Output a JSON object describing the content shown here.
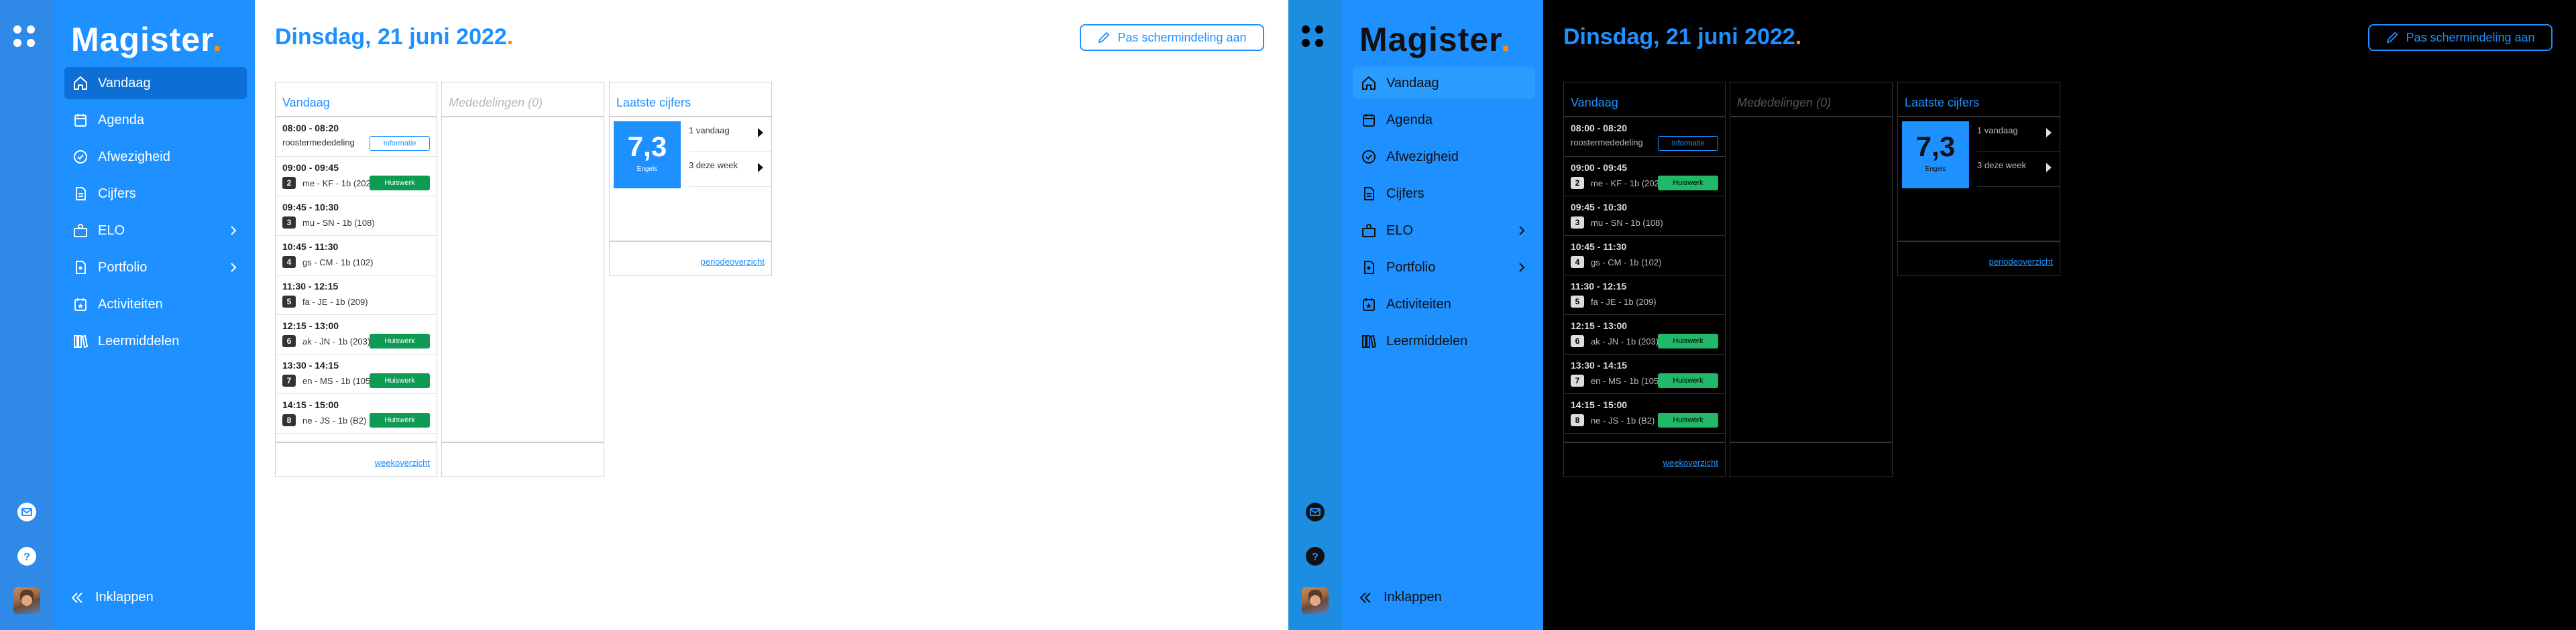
{
  "brand": {
    "name": "Magister",
    "dot": ".",
    "accent": "#1e90ff",
    "dot_color": "#ff8c00"
  },
  "date_title": "Dinsdag, 21 juni 2022",
  "date_dot": ".",
  "header_button": "Pas schermindeling aan",
  "nav": [
    {
      "label": "Vandaag",
      "icon": "home-icon",
      "active": true
    },
    {
      "label": "Agenda",
      "icon": "calendar-icon"
    },
    {
      "label": "Afwezigheid",
      "icon": "check-circle-icon"
    },
    {
      "label": "Cijfers",
      "icon": "grades-icon"
    },
    {
      "label": "ELO",
      "icon": "elo-icon",
      "submenu": true
    },
    {
      "label": "Portfolio",
      "icon": "portfolio-icon",
      "submenu": true
    },
    {
      "label": "Activiteiten",
      "icon": "activities-icon"
    },
    {
      "label": "Leermiddelen",
      "icon": "books-icon"
    }
  ],
  "collapse_label": "Inklappen",
  "vandaag": {
    "title": "Vandaag",
    "footer_link": "weekoverzicht",
    "rows": [
      {
        "time": "08:00 - 08:20",
        "hour": "",
        "desc": "roostermededeling",
        "badge": "Informatie",
        "badge_type": "info"
      },
      {
        "time": "09:00 - 09:45",
        "hour": "2",
        "desc": "me - KF - 1b (202)",
        "badge": "Huiswerk",
        "badge_type": "hw"
      },
      {
        "time": "09:45 - 10:30",
        "hour": "3",
        "desc": "mu - SN - 1b (108)",
        "badge": "",
        "badge_type": ""
      },
      {
        "time": "10:45 - 11:30",
        "hour": "4",
        "desc": "gs - CM - 1b (102)",
        "badge": "",
        "badge_type": ""
      },
      {
        "time": "11:30 - 12:15",
        "hour": "5",
        "desc": "fa - JE - 1b (209)",
        "badge": "",
        "badge_type": ""
      },
      {
        "time": "12:15 - 13:00",
        "hour": "6",
        "desc": "ak - JN - 1b (203)",
        "badge": "Huiswerk",
        "badge_type": "hw"
      },
      {
        "time": "13:30 - 14:15",
        "hour": "7",
        "desc": "en - MS - 1b (105)",
        "badge": "Huiswerk",
        "badge_type": "hw"
      },
      {
        "time": "14:15 - 15:00",
        "hour": "8",
        "desc": "ne - JS - 1b (B2)",
        "badge": "Huiswerk",
        "badge_type": "hw"
      }
    ]
  },
  "mededelingen": {
    "title": "Mededelingen (0)"
  },
  "cijfers": {
    "title": "Laatste cijfers",
    "grade": "7,3",
    "subject": "Engels",
    "rows": [
      "1 vandaag",
      "3 deze week"
    ],
    "footer_link": "periodeoverzicht"
  }
}
